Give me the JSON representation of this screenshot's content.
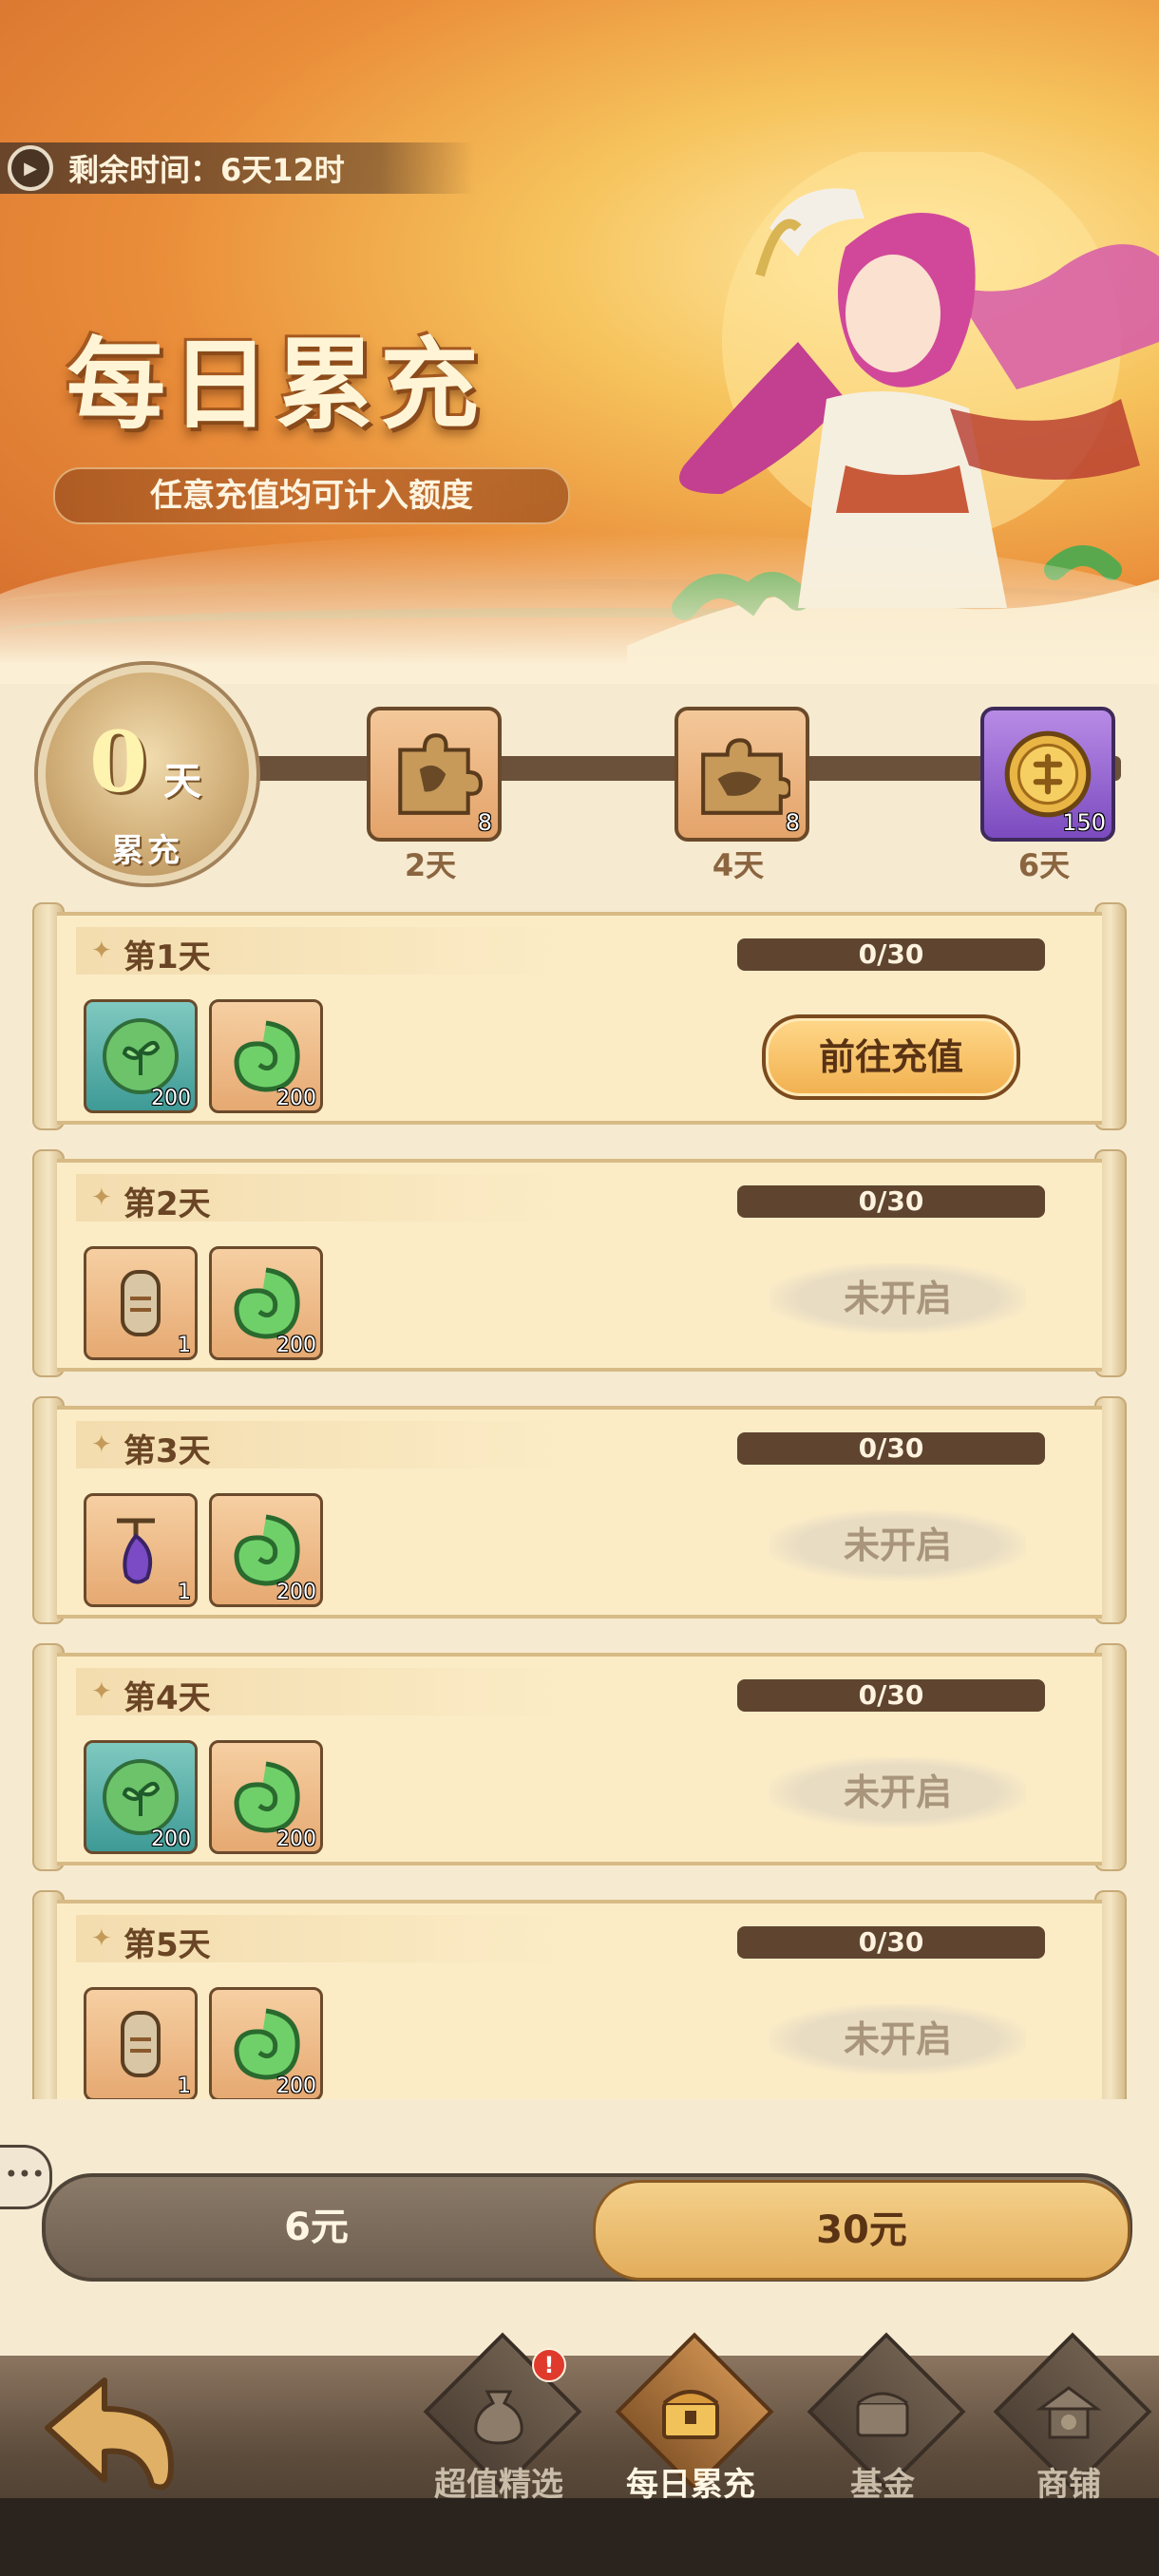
{
  "header": {
    "timer_text": "剩余时间：6天12时",
    "title": "每日累充",
    "subtitle": "任意充值均可计入额度"
  },
  "progress": {
    "days_value": "0",
    "days_unit": "天",
    "label": "累充",
    "milestones": [
      {
        "day": "2天",
        "count": "8",
        "icon": "puzzle-piece-icon"
      },
      {
        "day": "4天",
        "count": "8",
        "icon": "puzzle-piece-icon"
      },
      {
        "day": "6天",
        "count": "150",
        "icon": "gold-coin-icon"
      }
    ]
  },
  "tasks": [
    {
      "day": "第1天",
      "progress": "0/30",
      "rewards": [
        {
          "icon": "leaf-token-icon",
          "count": "200"
        },
        {
          "icon": "jade-swirl-icon",
          "count": "200"
        }
      ],
      "action": "前往充值",
      "status": "available"
    },
    {
      "day": "第2天",
      "progress": "0/30",
      "rewards": [
        {
          "icon": "scroll-token-icon",
          "count": "1"
        },
        {
          "icon": "jade-swirl-icon",
          "count": "200"
        }
      ],
      "action": "未开启",
      "status": "locked"
    },
    {
      "day": "第3天",
      "progress": "0/30",
      "rewards": [
        {
          "icon": "purple-crystal-icon",
          "count": "1"
        },
        {
          "icon": "jade-swirl-icon",
          "count": "200"
        }
      ],
      "action": "未开启",
      "status": "locked"
    },
    {
      "day": "第4天",
      "progress": "0/30",
      "rewards": [
        {
          "icon": "leaf-token-icon",
          "count": "200"
        },
        {
          "icon": "jade-swirl-icon",
          "count": "200"
        }
      ],
      "action": "未开启",
      "status": "locked"
    },
    {
      "day": "第5天",
      "progress": "0/30",
      "rewards": [
        {
          "icon": "scroll-token-icon",
          "count": "1"
        },
        {
          "icon": "jade-swirl-icon",
          "count": "200"
        }
      ],
      "action": "未开启",
      "status": "locked"
    }
  ],
  "amount_tabs": [
    {
      "label": "6元",
      "selected": false
    },
    {
      "label": "30元",
      "selected": true
    }
  ],
  "nav": {
    "items": [
      {
        "label": "超值精选",
        "icon": "money-bag-icon",
        "badge": "!"
      },
      {
        "label": "每日累充",
        "icon": "treasure-chest-icon",
        "active": true
      },
      {
        "label": "基金",
        "icon": "fund-chest-icon"
      },
      {
        "label": "商铺",
        "icon": "shop-pavilion-icon"
      }
    ]
  },
  "colors": {
    "banner_orange": "#d26a2c",
    "paper": "#fbecc6",
    "progress_bar": "#5f4530",
    "button_gold": "#f1b04e",
    "badge_red": "#e03a2c"
  }
}
